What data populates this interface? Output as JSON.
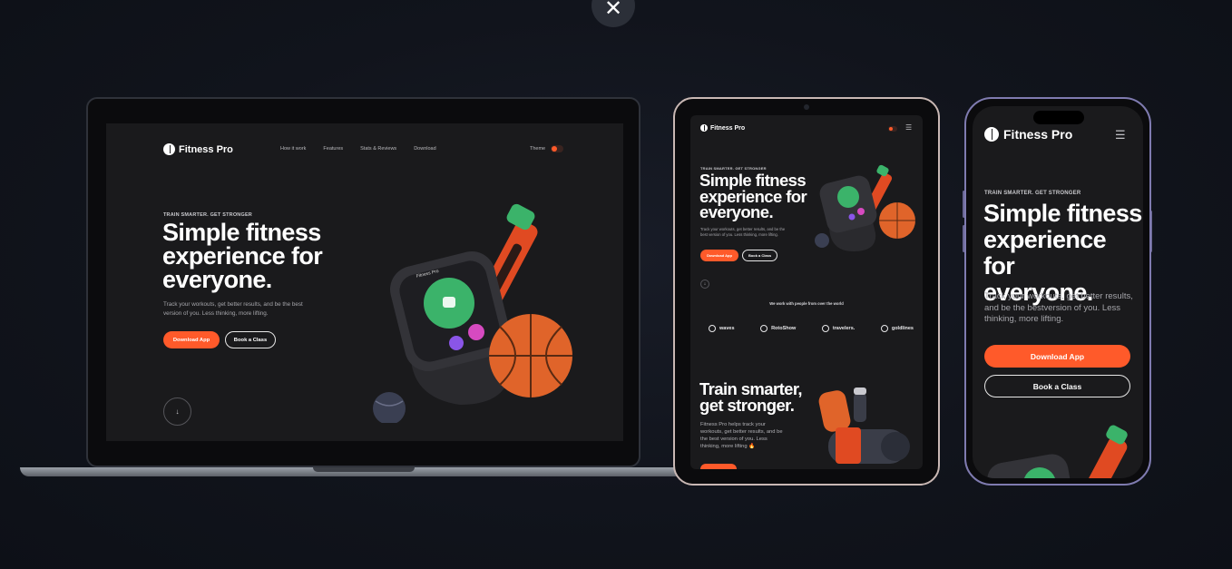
{
  "overlay": {
    "close_glyph": "✕"
  },
  "site": {
    "brand": "Fitness Pro",
    "nav": [
      "How it work",
      "Features",
      "Stats & Reviews",
      "Download"
    ],
    "theme_label": "Theme",
    "eyebrow": "TRAIN SMARTER. GET STRONGER",
    "headline_lines": [
      "Simple fitness",
      "experience for",
      "everyone."
    ],
    "desktop_sub_lines": [
      "Track your workouts, get better results, and be the best",
      "version of you. Less thinking, more lifting."
    ],
    "tablet_sub_lines": [
      "Track your workouts, get better results, and be the",
      "best version of you. Less thinking, more lifting."
    ],
    "phone_sub_lines": [
      "Track your workouts, get better results,",
      "and be the bestversion of you. Less",
      "thinking, more lifting."
    ],
    "cta_primary": "Download App",
    "cta_secondary": "Book a Class",
    "scroll_glyph": "↓",
    "menu_glyph": "☰",
    "partners_title": "We work with people from over the world",
    "partners": [
      "waves",
      "RotoShow",
      "travelers.",
      "goldlines"
    ],
    "section2_headline_lines": [
      "Train smarter,",
      "get stronger."
    ],
    "section2_text_lines": [
      "Fitness Pro helps track your",
      "workouts, get better results, and be",
      "the best version of you. Less",
      "thinking, more lifting 🔥"
    ],
    "watch_label": "Fitness Pro"
  },
  "icons": {
    "close": "close-icon",
    "logo": "logo-mark-icon",
    "scroll": "arrow-down-icon",
    "menu": "hamburger-menu-icon"
  },
  "colors": {
    "accent": "#ff5a2a",
    "background": "#11141c",
    "site_bg": "#1a1a1c",
    "watch_green": "#3bb36a",
    "ball_orange": "#e0642a"
  }
}
